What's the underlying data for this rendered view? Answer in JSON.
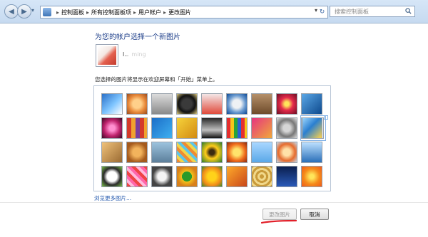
{
  "toolbar": {
    "breadcrumbs": [
      "控制面板",
      "所有控制面板项",
      "用户帐户",
      "更改图片"
    ],
    "search_placeholder": "搜索控制面板"
  },
  "main": {
    "title": "为您的帐户选择一个新图片",
    "username": "l... ming",
    "hint": "您选择的图片将显示在欢迎屏幕和「开始」菜单上。",
    "browse_link": "浏览更多图片..."
  },
  "buttons": {
    "change_picture": "更改图片",
    "cancel": "取消"
  },
  "colors": {
    "title": "#1e3f8a",
    "link": "#2a5db0",
    "annotation": "#e2202a"
  },
  "pictures": [
    [
      "abstract-blue",
      "starfish",
      "robot",
      "vinyl",
      "lucky-cat",
      "satellite",
      "kitten",
      "flower-red",
      "swirl-blue"
    ],
    [
      "yarn-ball",
      "color-blocks",
      "leaf-blue",
      "autumn-leaf",
      "dog",
      "crayons",
      "paper-pattern",
      "knot",
      "stairs",
      "origami-crane"
    ],
    [
      "guitar",
      "puppy",
      "robot-toy",
      "fabric",
      "sunflower",
      "fish",
      "balloon",
      "doll",
      "sailboat"
    ],
    [
      "soccer-ball",
      "mosaic",
      "pieces",
      "window-frame",
      "sunflower-orange",
      "butterfly",
      "spiral",
      "lighthouse",
      "gerbera"
    ]
  ]
}
